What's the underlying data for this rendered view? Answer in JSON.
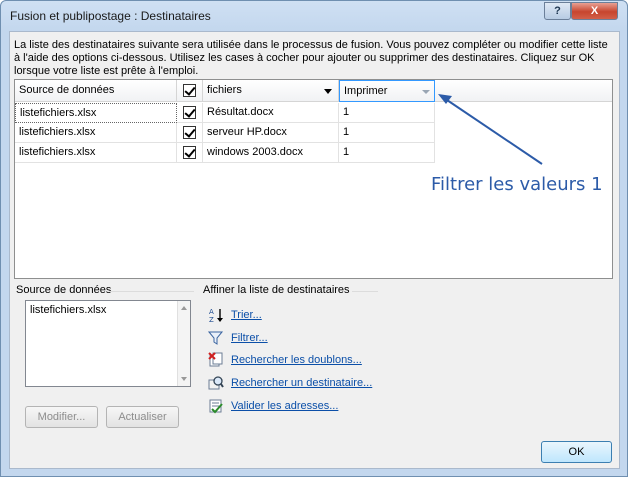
{
  "window": {
    "title": "Fusion et publipostage : Destinataires",
    "help_label": "?",
    "close_label": "X"
  },
  "description": "La liste des destinataires suivante sera utilisée dans le processus de fusion. Vous pouvez compléter ou modifier cette liste à l'aide des options ci-dessous. Utilisez les cases à cocher pour ajouter ou supprimer des destinataires. Cliquez sur OK lorsque votre liste est prête à l'emploi.",
  "grid": {
    "headers": [
      "Source de données",
      "",
      "fichiers",
      "Imprimer"
    ],
    "rows": [
      {
        "source": "listefichiers.xlsx",
        "checked": true,
        "fichiers": "Résultat.docx",
        "imprimer": "1"
      },
      {
        "source": "listefichiers.xlsx",
        "checked": true,
        "fichiers": "serveur HP.docx",
        "imprimer": "1"
      },
      {
        "source": "listefichiers.xlsx",
        "checked": true,
        "fichiers": "windows 2003.docx",
        "imprimer": "1"
      }
    ]
  },
  "annotation": {
    "text": "Filtrer les valeurs 1",
    "color": "#2c5ba8"
  },
  "source_panel": {
    "label": "Source de données",
    "items": [
      "listefichiers.xlsx"
    ],
    "modify_label": "Modifier...",
    "refresh_label": "Actualiser"
  },
  "refine_panel": {
    "label": "Affiner la liste de destinataires",
    "links": [
      {
        "label": "Trier...",
        "icon": "sort-az-icon"
      },
      {
        "label": "Filtrer...",
        "icon": "filter-icon"
      },
      {
        "label": "Rechercher les doublons...",
        "icon": "duplicates-icon"
      },
      {
        "label": "Rechercher un destinataire...",
        "icon": "find-recipient-icon"
      },
      {
        "label": "Valider les adresses...",
        "icon": "validate-addresses-icon"
      }
    ]
  },
  "ok_label": "OK"
}
